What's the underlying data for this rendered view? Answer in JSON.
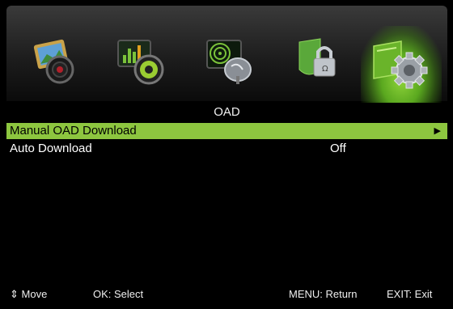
{
  "menu_icons": [
    {
      "name": "picture-menu-icon"
    },
    {
      "name": "sound-menu-icon"
    },
    {
      "name": "channel-menu-icon"
    },
    {
      "name": "lock-menu-icon"
    },
    {
      "name": "setup-menu-icon",
      "active": true
    }
  ],
  "page_title": "OAD",
  "items": [
    {
      "label": "Manual OAD Download",
      "value": "",
      "arrow": "▶",
      "selected": true
    },
    {
      "label": "Auto Download",
      "value": "Off",
      "selected": false
    }
  ],
  "footer": {
    "move_icon": "⇕",
    "move": "Move",
    "ok": "OK: Select",
    "menu": "MENU: Return",
    "exit": "EXIT: Exit"
  },
  "colors": {
    "accent": "#8dc63f",
    "background": "#000000"
  }
}
